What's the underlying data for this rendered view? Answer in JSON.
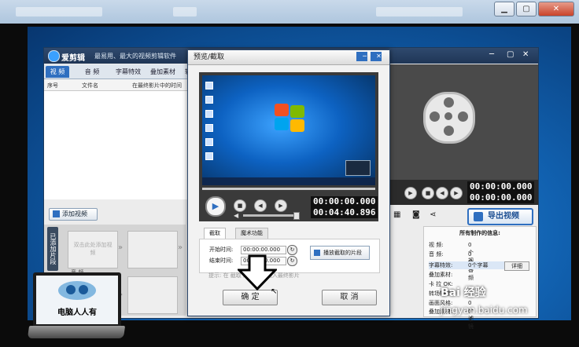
{
  "outer_window": {
    "minimize_glyph": "▁",
    "maximize_glyph": "▢",
    "close_glyph": "✕"
  },
  "app": {
    "name": "爱剪辑",
    "slogan": "最易用、最大的视频剪辑软件",
    "tabs": [
      "视 频",
      "音 频",
      "字幕特效",
      "叠加素材",
      "转"
    ],
    "table_headers": [
      "序号",
      "文件名",
      "在最终影片中的时间"
    ],
    "add_video_label": "添加视频",
    "strip_label": "已添加片段",
    "clip_placeholder": "双击此处添加视频",
    "audio_label": "音 频",
    "export_label": "导出视频",
    "right_timecodes": [
      "00:00:00.000",
      "00:00:00.000"
    ],
    "info": {
      "title": "所有制作的信息:",
      "rows": [
        {
          "label": "视    频:",
          "value": "0个视频"
        },
        {
          "label": "音    频:",
          "value": "0个音频"
        },
        {
          "label": "字幕特效:",
          "value": "0个字幕"
        },
        {
          "label": "叠加素材:",
          "value": ""
        },
        {
          "label": "卡    拉  OK:",
          "value": ""
        },
        {
          "label": "转场特效:",
          "value": ""
        },
        {
          "label": "画面风格:",
          "value": "0个滤镜"
        },
        {
          "label": "叠加素材:",
          "value": "0个"
        }
      ],
      "detail_button": "详细"
    }
  },
  "dialog": {
    "title": "预览/截取",
    "timecode_current": "00:00:00.000",
    "timecode_total": "00:04:40.896",
    "tabs": [
      "截取",
      "魔术功能"
    ],
    "start_label": "开始时间:",
    "start_value": "00:00:00.000",
    "end_label": "结束时间:",
    "end_value": "00:00:00.000",
    "play_selection_label": "播放截取的片段",
    "tip": "提示: 在 截取 的时间... 插入最终影片",
    "ok_label": "确 定",
    "cancel_label": "取 消"
  },
  "watermark": {
    "laptop_text": "电脑人人有",
    "brand": "Bai 经验",
    "url": "jingyan.baidu.com"
  }
}
